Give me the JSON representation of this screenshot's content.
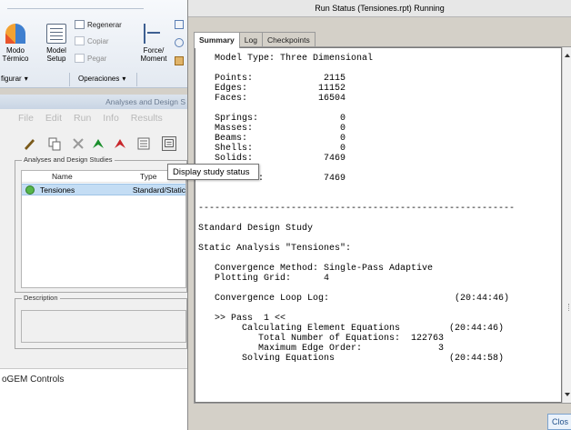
{
  "ribbon": {
    "modo_termico": {
      "line1": "Modo",
      "line2": "Térmico"
    },
    "model_setup": {
      "line1": "Model",
      "line2": "Setup"
    },
    "regenerar": "Regenerar",
    "copiar": "Copiar",
    "pegar": "Pegar",
    "force_moment": {
      "line1": "Force/",
      "line2": "Moment"
    },
    "group_configurar": "figurar",
    "group_operaciones": "Operaciones"
  },
  "analyses_panel": {
    "title": "Analyses and Design S",
    "menu": [
      "File",
      "Edit",
      "Run",
      "Info",
      "Results"
    ],
    "group_label": "Analyses and Design Studies",
    "columns": {
      "name": "Name",
      "type": "Type"
    },
    "rows": [
      {
        "name": "Tensiones",
        "type": "Standard/Static"
      }
    ],
    "description_label": "Description",
    "tooltip": "Display study status"
  },
  "footer_left": "oGEM Controls",
  "dialog": {
    "title": "Run Status (Tensiones.rpt) Running",
    "tabs": [
      "Summary",
      "Log",
      "Checkpoints"
    ],
    "active_tab": "Summary",
    "close_label": "Clos",
    "log_lines": [
      "   Model Type: Three Dimensional",
      "",
      "   Points:             2115",
      "   Edges:             11152",
      "   Faces:             16504",
      "",
      "   Springs:               0",
      "   Masses:                0",
      "   Beams:                 0",
      "   Shells:                0",
      "   Solids:             7469",
      "",
      "   Elements:           7469",
      "",
      "",
      "----------------------------------------------------------",
      "",
      "Standard Design Study",
      "",
      "Static Analysis \"Tensiones\":",
      "",
      "   Convergence Method: Single-Pass Adaptive",
      "   Plotting Grid:      4",
      "",
      "   Convergence Loop Log:                       (20:44:46)",
      "",
      "   >> Pass  1 <<",
      "        Calculating Element Equations         (20:44:46)",
      "           Total Number of Equations:  122763",
      "           Maximum Edge Order:              3",
      "        Solving Equations                     (20:44:58)"
    ]
  },
  "colors": {
    "selection": "#c4ddf4",
    "status_ok": "#56b64b",
    "ribbon_bg": "#e3e9f1"
  }
}
